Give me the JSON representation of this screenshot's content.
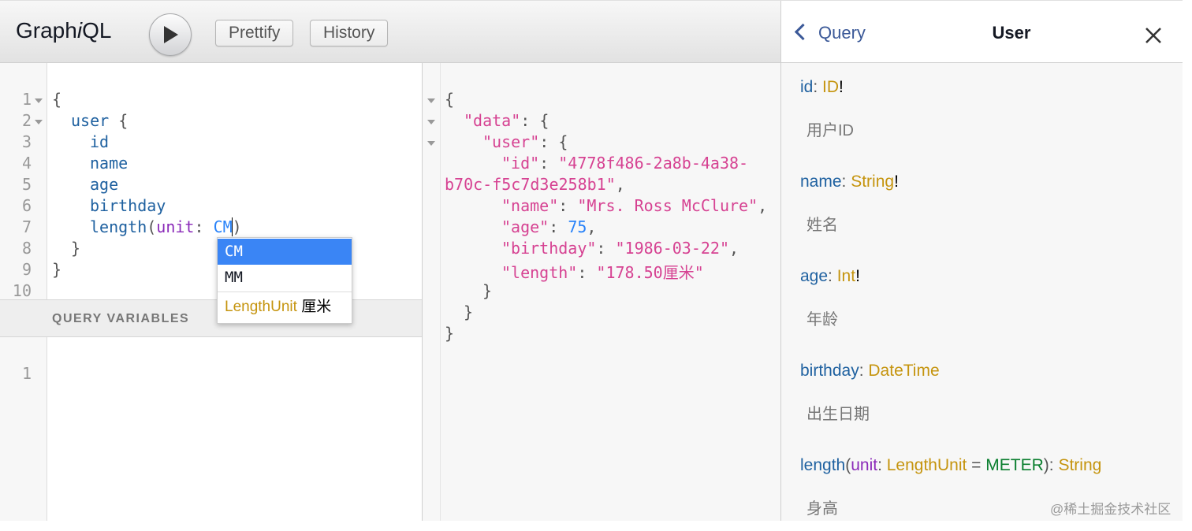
{
  "toolbar": {
    "title_prefix": "Graph",
    "title_italic": "i",
    "title_suffix": "QL",
    "prettify_label": "Prettify",
    "history_label": "History"
  },
  "editor": {
    "line_numbers": [
      "1",
      "2",
      "3",
      "4",
      "5",
      "6",
      "7",
      "8",
      "9",
      "10"
    ],
    "lines": {
      "l1": "{",
      "l2_field": "user",
      "l2_brace": " {",
      "l3": "id",
      "l4": "name",
      "l5": "age",
      "l6": "birthday",
      "l7_field": "length",
      "l7_paren": "(",
      "l7_arg": "unit",
      "l7_colon": ": ",
      "l7_value": "CM",
      "l7_close": ")",
      "l8": "}",
      "l9": "}"
    }
  },
  "autocomplete": {
    "items": [
      "CM",
      "MM"
    ],
    "active_index": 0,
    "info_type": "LengthUnit",
    "info_desc": "厘米"
  },
  "variables": {
    "header": "QUERY VARIABLES",
    "line_numbers": [
      "1"
    ]
  },
  "result": {
    "l1": "{",
    "data_key": "\"data\"",
    "user_key": "\"user\"",
    "id_key": "\"id\"",
    "id_value_a": "\"4778f486-2a8b-4a38-",
    "id_value_b": "b70c-f5c7d3e258b1\"",
    "name_key": "\"name\"",
    "name_value": "\"Mrs. Ross McClure\"",
    "age_key": "\"age\"",
    "age_value": "75",
    "birthday_key": "\"birthday\"",
    "birthday_value": "\"1986-03-22\"",
    "length_key": "\"length\"",
    "length_value": "\"178.50厘米\"",
    "close_user": "}",
    "close_data": "}",
    "close_root": "}"
  },
  "docs": {
    "back_label": "Query",
    "title": "User",
    "fields": [
      {
        "name": "id",
        "type": "ID",
        "bang": "!",
        "desc": "用户ID"
      },
      {
        "name": "name",
        "type": "String",
        "bang": "!",
        "desc": "姓名"
      },
      {
        "name": "age",
        "type": "Int",
        "bang": "!",
        "desc": "年龄"
      },
      {
        "name": "birthday",
        "type": "DateTime",
        "bang": "",
        "desc": "出生日期"
      }
    ],
    "length_field": {
      "name": "length",
      "arg": "unit",
      "arg_type": "LengthUnit",
      "eq": " = ",
      "default": "METER",
      "ret": "String",
      "desc": "身高"
    }
  },
  "watermark": "@稀土掘金技术社区",
  "colors": {
    "accent_blue": "#3a85f5",
    "keyword": "#1f61a0",
    "string": "#d64292",
    "type": "#c5940e",
    "default_value": "#0b7f2f"
  }
}
